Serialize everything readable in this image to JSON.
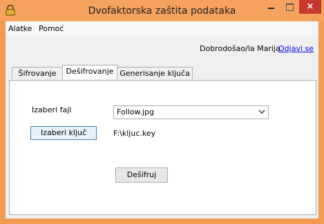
{
  "window": {
    "title": "Dvofaktorska zaštita podataka",
    "close_glyph": "×",
    "icons": [
      "lock-icon",
      "minimize-icon",
      "maximize-icon",
      "close-icon"
    ]
  },
  "menu": {
    "items": [
      "Alatke",
      "Pomoć"
    ]
  },
  "header": {
    "welcome": "Dobrodošao/la Marija",
    "logout": "Odjavi se"
  },
  "tabs": [
    {
      "label": "Šifrovanje",
      "active": false
    },
    {
      "label": "Dešifrovanje",
      "active": true
    },
    {
      "label": "Generisanje ključa",
      "active": false
    }
  ],
  "decrypt": {
    "file_label": "Izaberi fajl",
    "file_value": "Follow.jpg",
    "choose_key_button": "Izaberi ključ",
    "key_path": "F:\\kljuc.key",
    "decrypt_button": "Dešifruj"
  },
  "colors": {
    "titlebar": "#f4a25e",
    "close": "#c7372f",
    "link": "#0000ee"
  }
}
